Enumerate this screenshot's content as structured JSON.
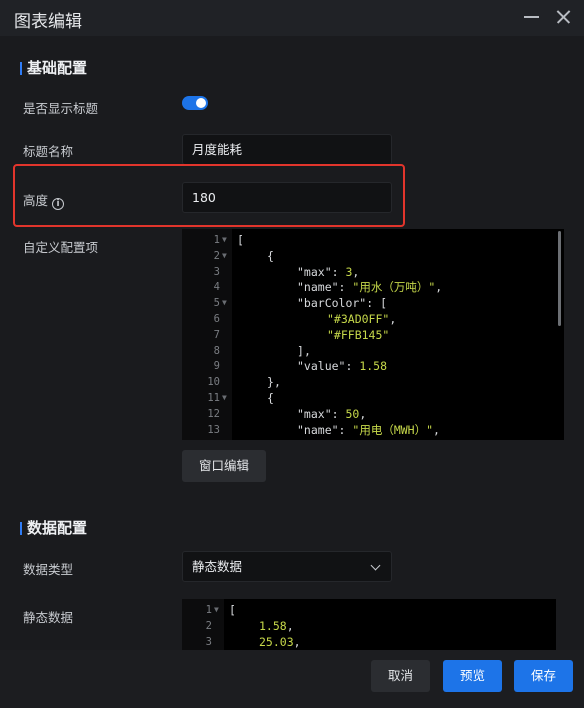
{
  "window": {
    "title": "图表编辑"
  },
  "basic": {
    "section_title": "基础配置",
    "show_title_label": "是否显示标题",
    "show_title_on": true,
    "title_name_label": "标题名称",
    "title_name_value": "月度能耗",
    "height_label": "高度",
    "height_value": "180",
    "custom_config_label": "自定义配置项",
    "window_edit_label": "窗口编辑"
  },
  "custom_config_code": [
    {
      "n": "1",
      "fold": true,
      "indent": 0,
      "tokens": [
        [
          "br",
          "["
        ]
      ]
    },
    {
      "n": "2",
      "fold": true,
      "indent": 1,
      "tokens": [
        [
          "br",
          "{"
        ]
      ]
    },
    {
      "n": "3",
      "fold": false,
      "indent": 2,
      "tokens": [
        [
          "key",
          "\"max\""
        ],
        [
          "punc",
          ": "
        ],
        [
          "num",
          "3"
        ],
        [
          "punc",
          ","
        ]
      ]
    },
    {
      "n": "4",
      "fold": false,
      "indent": 2,
      "tokens": [
        [
          "key",
          "\"name\""
        ],
        [
          "punc",
          ": "
        ],
        [
          "str",
          "\"用水（万吨）\""
        ],
        [
          "punc",
          ","
        ]
      ]
    },
    {
      "n": "5",
      "fold": true,
      "indent": 2,
      "tokens": [
        [
          "key",
          "\"barColor\""
        ],
        [
          "punc",
          ": "
        ],
        [
          "br",
          "["
        ]
      ]
    },
    {
      "n": "6",
      "fold": false,
      "indent": 3,
      "tokens": [
        [
          "str",
          "\"#3AD0FF\""
        ],
        [
          "punc",
          ","
        ]
      ]
    },
    {
      "n": "7",
      "fold": false,
      "indent": 3,
      "tokens": [
        [
          "str",
          "\"#FFB145\""
        ]
      ]
    },
    {
      "n": "8",
      "fold": false,
      "indent": 2,
      "tokens": [
        [
          "br",
          "]"
        ],
        [
          "punc",
          ","
        ]
      ]
    },
    {
      "n": "9",
      "fold": false,
      "indent": 2,
      "tokens": [
        [
          "key",
          "\"value\""
        ],
        [
          "punc",
          ": "
        ],
        [
          "num",
          "1.58"
        ]
      ]
    },
    {
      "n": "10",
      "fold": false,
      "indent": 1,
      "tokens": [
        [
          "br",
          "}"
        ],
        [
          "punc",
          ","
        ]
      ]
    },
    {
      "n": "11",
      "fold": true,
      "indent": 1,
      "tokens": [
        [
          "br",
          "{"
        ]
      ]
    },
    {
      "n": "12",
      "fold": false,
      "indent": 2,
      "tokens": [
        [
          "key",
          "\"max\""
        ],
        [
          "punc",
          ": "
        ],
        [
          "num",
          "50"
        ],
        [
          "punc",
          ","
        ]
      ]
    },
    {
      "n": "13",
      "fold": false,
      "indent": 2,
      "tokens": [
        [
          "key",
          "\"name\""
        ],
        [
          "punc",
          ": "
        ],
        [
          "str",
          "\"用电（MWH）\""
        ],
        [
          "punc",
          ","
        ]
      ]
    }
  ],
  "data": {
    "section_title": "数据配置",
    "type_label": "数据类型",
    "type_value": "静态数据",
    "static_label": "静态数据"
  },
  "static_data_code": [
    {
      "n": "1",
      "fold": true,
      "indent": 0,
      "tokens": [
        [
          "br",
          "["
        ]
      ]
    },
    {
      "n": "2",
      "fold": false,
      "indent": 1,
      "tokens": [
        [
          "num",
          "1.58"
        ],
        [
          "punc",
          ","
        ]
      ]
    },
    {
      "n": "3",
      "fold": false,
      "indent": 1,
      "tokens": [
        [
          "num",
          "25.03"
        ],
        [
          "punc",
          ","
        ]
      ]
    }
  ],
  "footer": {
    "cancel": "取消",
    "preview": "预览",
    "save": "保存"
  },
  "colors": {
    "accent": "#1d74e8",
    "highlight_border": "#e2352c",
    "string_token": "#c6d84a"
  }
}
